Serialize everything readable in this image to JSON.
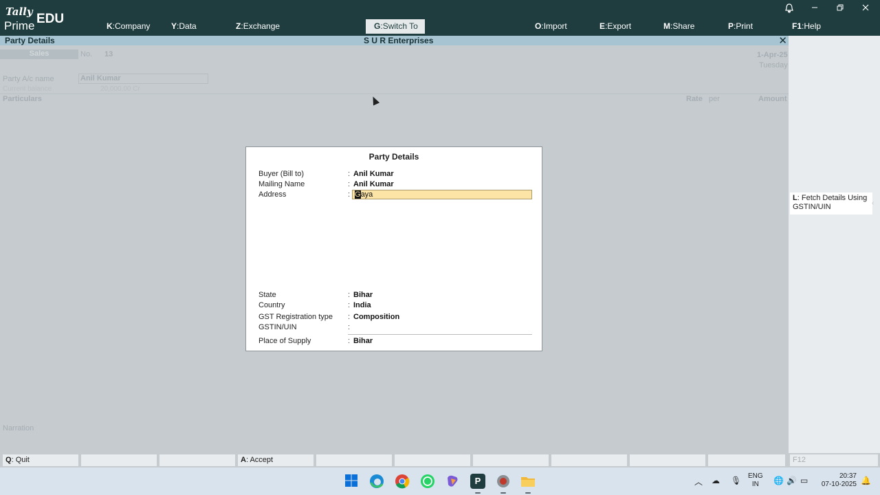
{
  "app": {
    "logo_brand": "Tally",
    "logo_product": "Prime",
    "logo_edition": "EDU"
  },
  "menu": [
    {
      "key": "K",
      "label": "Company"
    },
    {
      "key": "Y",
      "label": "Data"
    },
    {
      "key": "Z",
      "label": "Exchange"
    },
    {
      "key": "G",
      "label": "Switch To"
    },
    {
      "key": "O",
      "label": "Import"
    },
    {
      "key": "E",
      "label": "Export"
    },
    {
      "key": "M",
      "label": "Share"
    },
    {
      "key": "P",
      "label": "Print"
    },
    {
      "key": "F1",
      "label": "Help"
    }
  ],
  "window_controls": {
    "bell": "bell-icon",
    "minimize": "minimize-icon",
    "restore": "restore-icon",
    "close": "close-icon"
  },
  "title_bar": {
    "screen_title": "Party Details",
    "company": "S U R Enterprises"
  },
  "voucher_background": {
    "type": "Sales",
    "no_label": "No.",
    "no_value": "13",
    "date": "1-Apr-25",
    "day": "Tuesday",
    "party_label": "Party A/c name",
    "party_value": "Anil Kumar",
    "balance_label": "Current balance",
    "balance_value": "20,000.00 Cr",
    "particulars": "Particulars",
    "rate": "Rate",
    "per": "per",
    "amount": "Amount",
    "narration": "Narration"
  },
  "dialog": {
    "title": "Party Details",
    "buyer_label": "Buyer (Bill to)",
    "buyer_value": "Anil Kumar",
    "mailing_label": "Mailing Name",
    "mailing_value": "Anil Kumar",
    "address_label": "Address",
    "address_first_char": "G",
    "address_rest": "aya",
    "state_label": "State",
    "state_value": "Bihar",
    "country_label": "Country",
    "country_value": "India",
    "gst_type_label": "GST Registration type",
    "gst_type_value": "Composition",
    "gstin_label": "GSTIN/UIN",
    "gstin_value": "",
    "supply_label": "Place of Supply",
    "supply_value": "Bihar",
    "colon": ":"
  },
  "right_panel": {
    "fetch_key": "L",
    "fetch_label": "Fetch Details Using GSTIN/UIN"
  },
  "bottom_bar": {
    "quit_key": "Q",
    "quit_label": "Quit",
    "accept_key": "A",
    "accept_label": "Accept",
    "f12_label": "F12"
  },
  "taskbar": {
    "lang_line1": "ENG",
    "lang_line2": "IN",
    "time": "20:37",
    "date": "07-10-2025"
  }
}
